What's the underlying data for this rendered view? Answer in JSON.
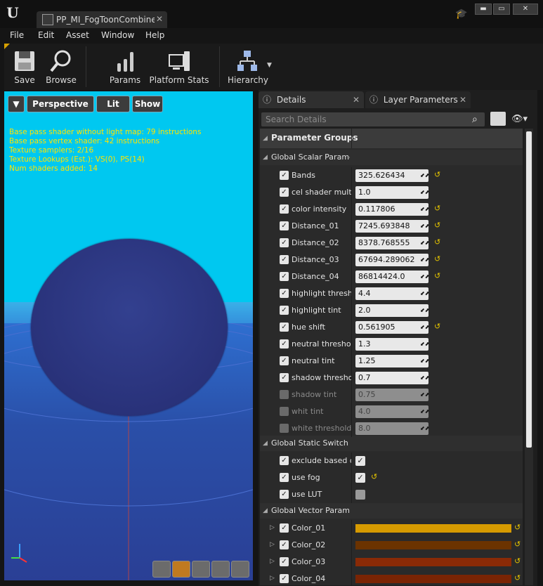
{
  "window": {
    "tab_title": "PP_MI_FogToonCombine*",
    "close_tab_glyph": "✕",
    "controls": {
      "minimize": "▬",
      "maximize": "▭",
      "close": "✕"
    }
  },
  "menu": [
    "File",
    "Edit",
    "Asset",
    "Window",
    "Help"
  ],
  "toolbar": {
    "save": "Save",
    "browse": "Browse",
    "params": "Params",
    "platform_stats": "Platform Stats",
    "hierarchy": "Hierarchy"
  },
  "viewport": {
    "perspective": "Perspective",
    "lit": "Lit",
    "show": "Show",
    "stats": [
      "Base pass shader without light map: 79 instructions",
      "Base pass vertex shader: 42 instructions",
      "Texture samplers: 2/16",
      "Texture Lookups (Est.): VS(0), PS(14)",
      "Num shaders added: 14"
    ]
  },
  "panel": {
    "tabs": {
      "details": "Details",
      "layer_parameters": "Layer Parameters"
    },
    "search_placeholder": "Search Details",
    "parameter_groups": "Parameter Groups",
    "groups": {
      "scalar": "Global Scalar Paramet",
      "static_switch": "Global Static Switch P",
      "vector": "Global Vector Paramet"
    },
    "scalar_params": [
      {
        "label": "Bands",
        "value": "325.626434"
      },
      {
        "label": "cel shader multip",
        "value": "1.0"
      },
      {
        "label": "color intensity",
        "value": "0.117806"
      },
      {
        "label": "Distance_01",
        "value": "7245.693848"
      },
      {
        "label": "Distance_02",
        "value": "8378.768555"
      },
      {
        "label": "Distance_03",
        "value": "67694.289062"
      },
      {
        "label": "Distance_04",
        "value": "86814424.0"
      },
      {
        "label": "highlight threshol",
        "value": "4.4"
      },
      {
        "label": "highlight tint",
        "value": "2.0"
      },
      {
        "label": "hue shift",
        "value": "0.561905"
      },
      {
        "label": "neutral threshold",
        "value": "1.3"
      },
      {
        "label": "neutral tint",
        "value": "1.25"
      },
      {
        "label": "shadow threshold",
        "value": "0.7"
      },
      {
        "label": "shadow tint",
        "value": "0.75"
      },
      {
        "label": "whit tint",
        "value": "4.0"
      },
      {
        "label": "white threshold",
        "value": "8.0"
      }
    ],
    "switch_params": [
      {
        "label": "exclude based on"
      },
      {
        "label": "use fog"
      },
      {
        "label": "use LUT"
      }
    ],
    "vector_params": [
      {
        "label": "Color_01",
        "color": "#d69a00"
      },
      {
        "label": "Color_02",
        "color": "#6b3300"
      },
      {
        "label": "Color_03",
        "color": "#8a2a06"
      },
      {
        "label": "Color_04",
        "color": "#7a2404"
      }
    ]
  },
  "colors": {
    "accent": "#d8a100",
    "viewport_sky": "#00c8f0",
    "reset_arrow": "#e2c200"
  }
}
